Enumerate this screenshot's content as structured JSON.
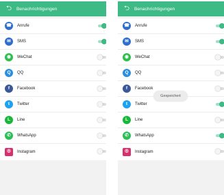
{
  "screens": [
    {
      "header": {
        "title": "Benachrichtigungen"
      },
      "items": [
        {
          "label": "Anrufe",
          "on": true,
          "icon": "phone-icon",
          "symbol": "☎",
          "color": "#2f6ecf",
          "shape": "round"
        },
        {
          "label": "SMS",
          "on": true,
          "icon": "sms-icon",
          "symbol": "✉",
          "color": "#2f6ecf",
          "shape": "round"
        },
        {
          "label": "WeChat",
          "on": false,
          "icon": "wechat-icon",
          "symbol": "◉",
          "color": "#2fbf4f",
          "shape": "round"
        },
        {
          "label": "QQ",
          "on": false,
          "icon": "qq-icon",
          "symbol": "Q",
          "color": "#2a8fe0",
          "shape": "round"
        },
        {
          "label": "Facebook",
          "on": false,
          "icon": "facebook-icon",
          "symbol": "f",
          "color": "#3b5998",
          "shape": "round"
        },
        {
          "label": "Twitter",
          "on": false,
          "icon": "twitter-icon",
          "symbol": "t",
          "color": "#1da1f2",
          "shape": "round"
        },
        {
          "label": "Line",
          "on": false,
          "icon": "line-icon",
          "symbol": "L",
          "color": "#17b83a",
          "shape": "round"
        },
        {
          "label": "WhatsApp",
          "on": false,
          "icon": "whatsapp-icon",
          "symbol": "✆",
          "color": "#2bbf55",
          "shape": "round"
        },
        {
          "label": "Instagram",
          "on": false,
          "icon": "instagram-icon",
          "symbol": "◎",
          "color": "#d6306f",
          "shape": "square"
        }
      ]
    },
    {
      "header": {
        "title": "Benachrichtigungen"
      },
      "toast": "Gespeichert",
      "items": [
        {
          "label": "Anrufe",
          "on": true,
          "icon": "phone-icon",
          "symbol": "☎",
          "color": "#2f6ecf",
          "shape": "round"
        },
        {
          "label": "SMS",
          "on": true,
          "icon": "sms-icon",
          "symbol": "✉",
          "color": "#2f6ecf",
          "shape": "round"
        },
        {
          "label": "WeChat",
          "on": false,
          "icon": "wechat-icon",
          "symbol": "◉",
          "color": "#2fbf4f",
          "shape": "round"
        },
        {
          "label": "QQ",
          "on": false,
          "icon": "qq-icon",
          "symbol": "Q",
          "color": "#2a8fe0",
          "shape": "round"
        },
        {
          "label": "Facebook",
          "on": false,
          "icon": "facebook-icon",
          "symbol": "f",
          "color": "#3b5998",
          "shape": "round"
        },
        {
          "label": "Twitter",
          "on": true,
          "icon": "twitter-icon",
          "symbol": "t",
          "color": "#1da1f2",
          "shape": "round"
        },
        {
          "label": "Line",
          "on": false,
          "icon": "line-icon",
          "symbol": "L",
          "color": "#17b83a",
          "shape": "round"
        },
        {
          "label": "WhatsApp",
          "on": true,
          "icon": "whatsapp-icon",
          "symbol": "✆",
          "color": "#2bbf55",
          "shape": "round"
        },
        {
          "label": "Instagram",
          "on": false,
          "icon": "instagram-icon",
          "symbol": "◎",
          "color": "#d6306f",
          "shape": "square"
        }
      ]
    }
  ],
  "colors": {
    "accent": "#3dba85",
    "toggle_off": "#dcdcdc"
  }
}
